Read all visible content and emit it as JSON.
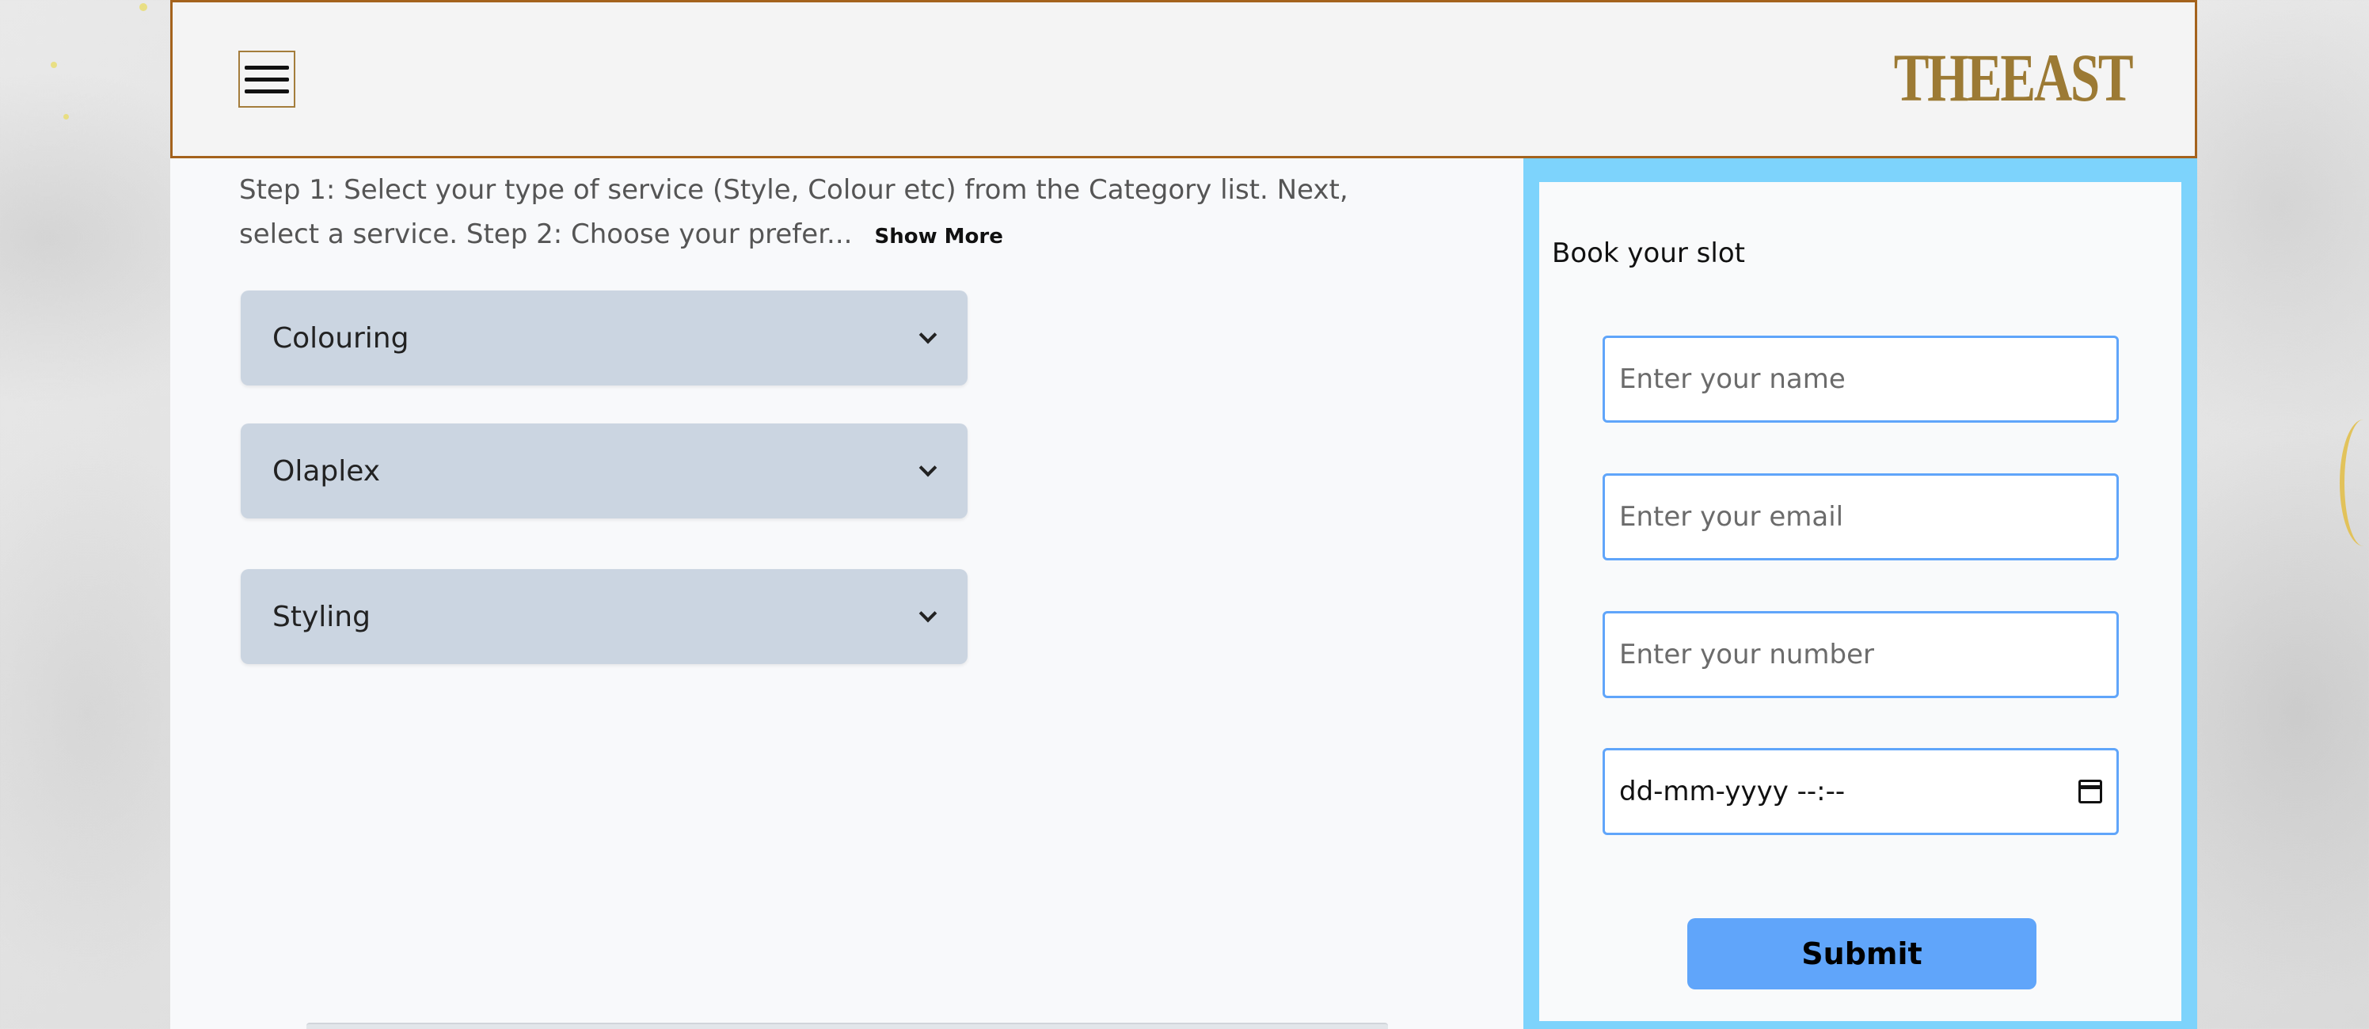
{
  "header": {
    "logo": "THEEAST",
    "menu_icon": "hamburger-menu-icon"
  },
  "intro": {
    "text": "Step 1: Select your type of service (Style, Colour etc) from the Category list. Next, select a service. Step 2: Choose your prefer...",
    "show_more_label": "Show More"
  },
  "categories": [
    {
      "label": "Colouring",
      "icon": "chevron-down-icon"
    },
    {
      "label": "Olaplex",
      "icon": "chevron-down-icon"
    },
    {
      "label": "Styling",
      "icon": "chevron-down-icon"
    }
  ],
  "booking": {
    "title": "Book your slot",
    "name_placeholder": "Enter your name",
    "email_placeholder": "Enter your email",
    "number_placeholder": "Enter your number",
    "datetime_placeholder": "dd-mm-yyyy --:--",
    "calendar_icon": "calendar-icon",
    "submit_label": "Submit"
  },
  "colors": {
    "header_border": "#a4621c",
    "logo": "#9c7a34",
    "category_bg": "#cbd5e1",
    "booking_frame": "#7dd3fc",
    "accent": "#60a5fa"
  }
}
